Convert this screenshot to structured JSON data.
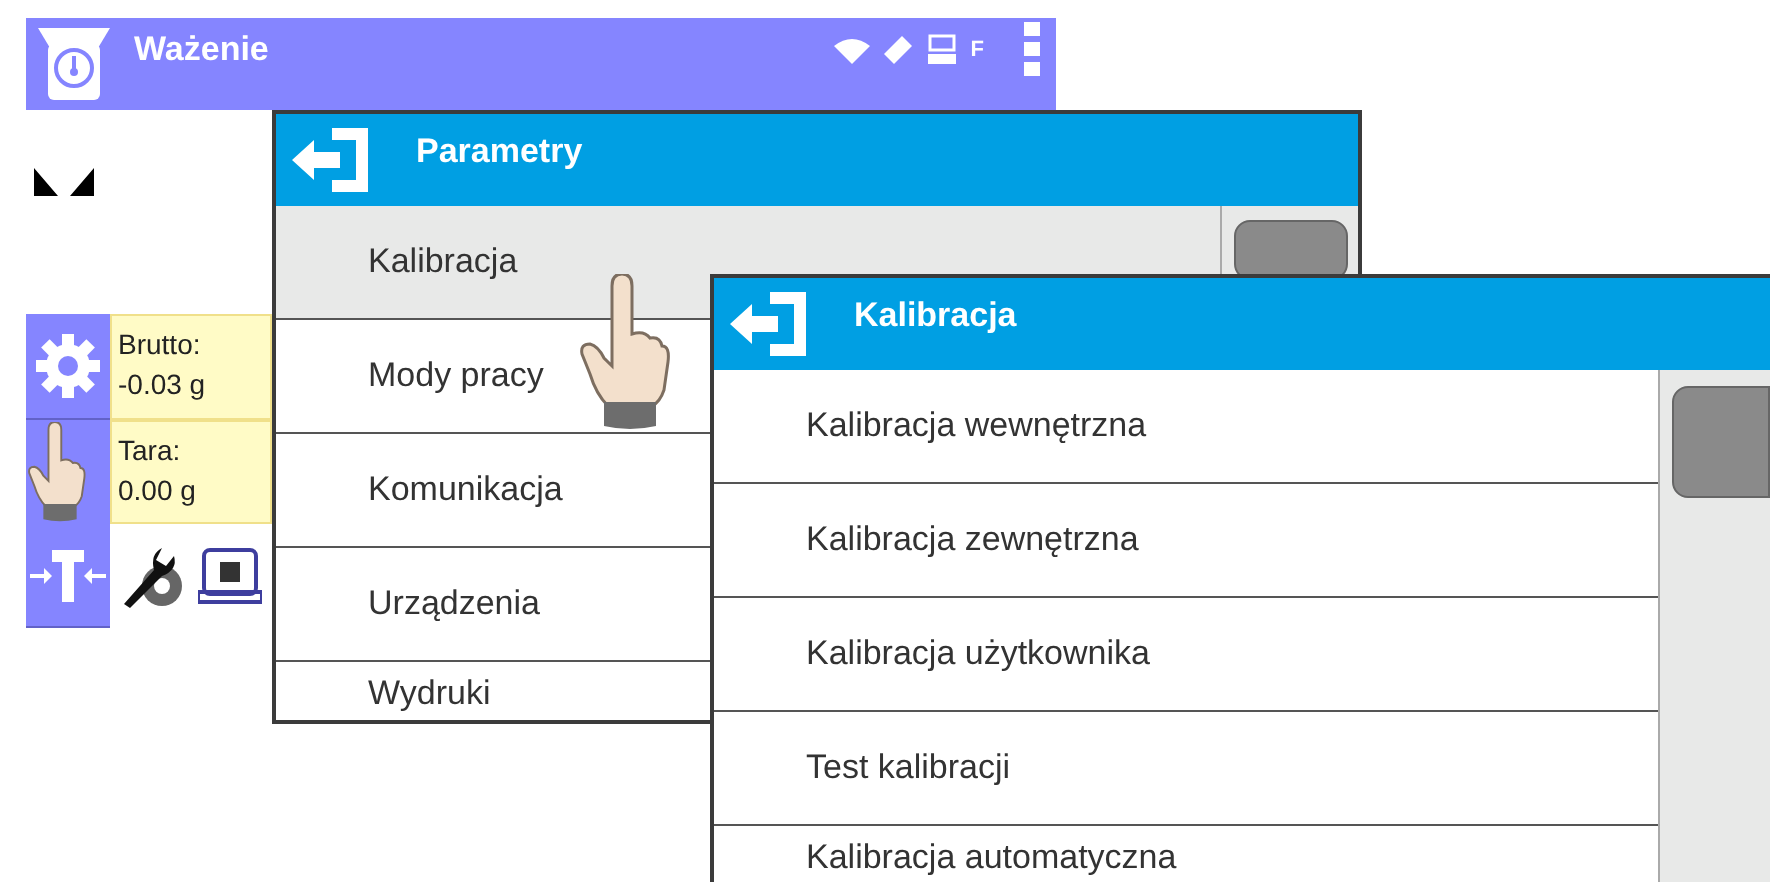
{
  "status_bar": {
    "title": "Ważenie",
    "indicator": "F"
  },
  "weighing": {
    "readouts": [
      {
        "label": "Brutto:",
        "value": "-0.03 g"
      },
      {
        "label": "Tara:",
        "value": "0.00 g"
      }
    ]
  },
  "windows": [
    {
      "title": "Parametry",
      "items": [
        {
          "label": "Kalibracja",
          "selected": true
        },
        {
          "label": "Mody pracy",
          "selected": false
        },
        {
          "label": "Komunikacja",
          "selected": false
        },
        {
          "label": "Urządzenia",
          "selected": false
        },
        {
          "label": "Wydruki",
          "selected": false
        }
      ]
    },
    {
      "title": "Kalibracja",
      "items": [
        {
          "label": "Kalibracja wewnętrzna",
          "selected": false
        },
        {
          "label": "Kalibracja zewnętrzna",
          "selected": false
        },
        {
          "label": "Kalibracja użytkownika",
          "selected": false
        },
        {
          "label": "Test kalibracji",
          "selected": false
        },
        {
          "label": "Kalibracja automatyczna",
          "selected": false
        }
      ]
    }
  ]
}
